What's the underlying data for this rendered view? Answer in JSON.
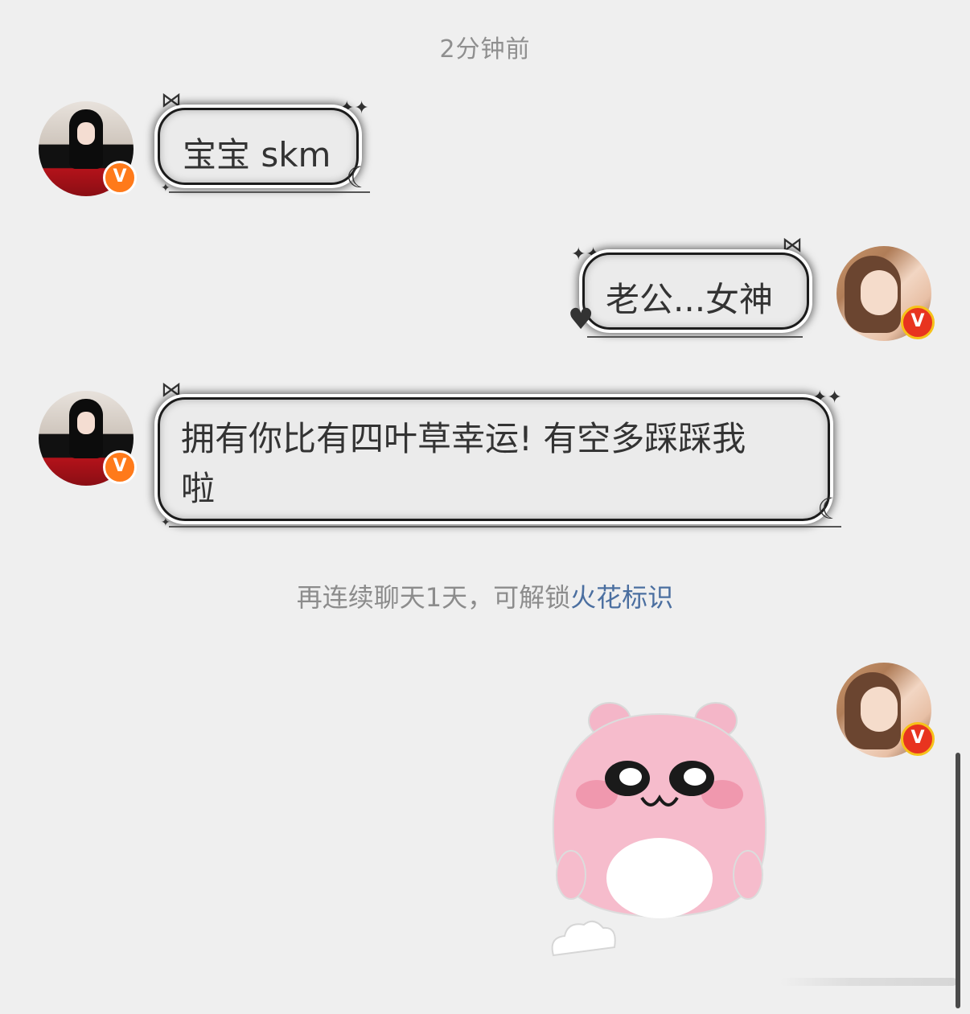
{
  "chat": {
    "timestamp": "2分钟前",
    "messages": [
      {
        "sender": "other",
        "text": "宝宝 skm"
      },
      {
        "sender": "self",
        "text": "老公...女神"
      },
      {
        "sender": "other",
        "text": "拥有你比有四叶草幸运! 有空多踩踩我啦"
      },
      {
        "sender": "self",
        "type": "sticker",
        "sticker_icon": "pink-bear-sticker"
      }
    ],
    "hint": {
      "prefix": "再连续聊天1天，可解锁",
      "link": "火花标识"
    },
    "badge_label": "V"
  },
  "colors": {
    "background": "#efefef",
    "link": "#4b6fa0",
    "badge_orange": "#ff7a1a",
    "badge_red": "#e8341f",
    "badge_ring_gold": "#f6c21a"
  }
}
